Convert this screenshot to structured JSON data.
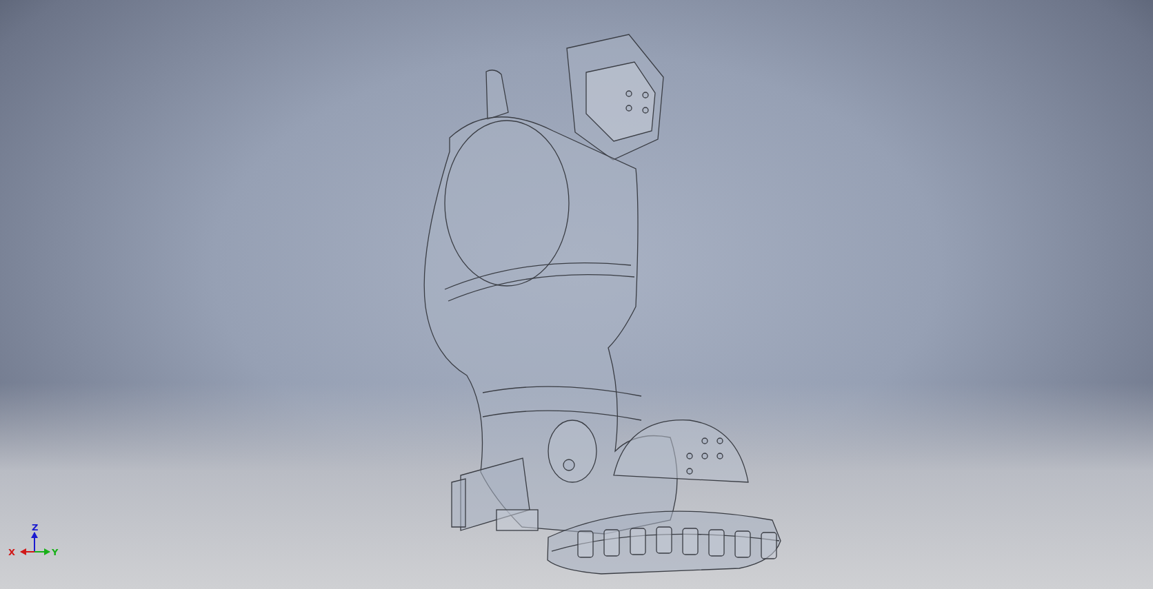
{
  "viewport": {
    "axes": [
      {
        "kind": "z",
        "label": "Z",
        "color": "#1a1ad0"
      },
      {
        "kind": "x",
        "label": "X",
        "color": "#d01818"
      },
      {
        "kind": "y",
        "label": "Y",
        "color": "#18b018"
      }
    ]
  }
}
